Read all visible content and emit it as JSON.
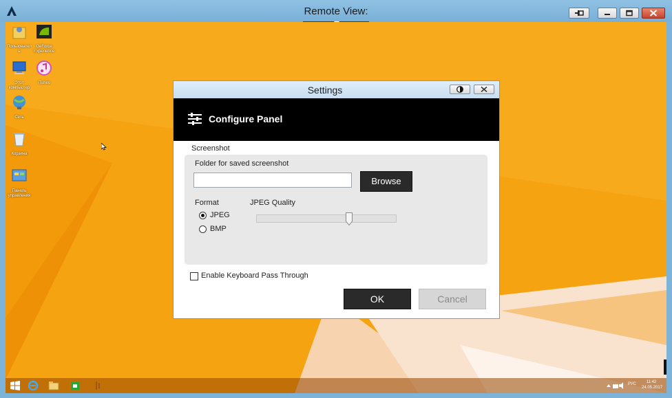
{
  "window": {
    "title": "Remote View:",
    "buttons": [
      "pin",
      "minimize",
      "restore",
      "close"
    ]
  },
  "desktop": {
    "icons": [
      {
        "icon": "user-folder-icon",
        "label": "Пользовател\nь"
      },
      {
        "icon": "nvidia-icon",
        "label": "GeForce Experience"
      },
      {
        "icon": "computer-icon",
        "label": "Этот компьютер"
      },
      {
        "icon": "itunes-icon",
        "label": "iTunes"
      },
      {
        "icon": "network-icon",
        "label": "Сеть"
      },
      {
        "icon": "recycle-bin-icon",
        "label": "Корзина"
      },
      {
        "icon": "control-panel-icon",
        "label": "Панель управления"
      }
    ],
    "taskbar": {
      "tray_lang": "РУС",
      "time": "11:42",
      "date": "24.05.2017"
    }
  },
  "dialog": {
    "title": "Settings",
    "banner_title": "Configure Panel",
    "section_label": "Screenshot",
    "folder_label": "Folder for saved screenshot",
    "folder_value": "",
    "browse_label": "Browse",
    "format_label": "Format",
    "format_options": [
      "JPEG",
      "BMP"
    ],
    "format_selected": "JPEG",
    "quality_label": "JPEG Quality",
    "quality_level": 0.67,
    "keyboard_label": "Enable Keyboard Pass Through",
    "keyboard_checked": false,
    "ok_label": "OK",
    "cancel_label": "Cancel"
  },
  "colors": {
    "wallpaper": "#f5a311",
    "frame": "#7db3d8",
    "banner": "#000000",
    "primary_button": "#2a2a2a",
    "disabled_button": "#d6d6d6"
  }
}
